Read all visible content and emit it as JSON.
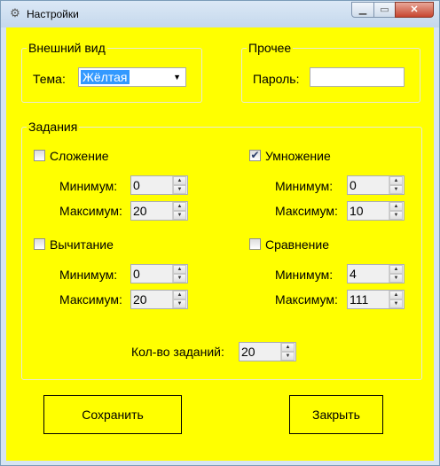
{
  "window": {
    "title": "Настройки",
    "icon": "gear-icon"
  },
  "appearance": {
    "legend": "Внешний вид",
    "theme_label": "Тема:",
    "theme_value": "Жёлтая"
  },
  "other": {
    "legend": "Прочее",
    "password_label": "Пароль:",
    "password_value": ""
  },
  "tasks": {
    "legend": "Задания",
    "min_label": "Минимум:",
    "max_label": "Максимум:",
    "addition": {
      "label": "Сложение",
      "checked": false,
      "min": "0",
      "max": "20"
    },
    "multiplication": {
      "label": "Умножение",
      "checked": true,
      "min": "0",
      "max": "10"
    },
    "subtraction": {
      "label": "Вычитание",
      "checked": false,
      "min": "0",
      "max": "20"
    },
    "comparison": {
      "label": "Сравнение",
      "checked": false,
      "min": "4",
      "max": "111"
    },
    "count_label": "Кол-во заданий:",
    "count_value": "20"
  },
  "buttons": {
    "save": "Сохранить",
    "close": "Закрыть"
  },
  "colors": {
    "background": "#ffff00",
    "selection": "#3399ff"
  }
}
